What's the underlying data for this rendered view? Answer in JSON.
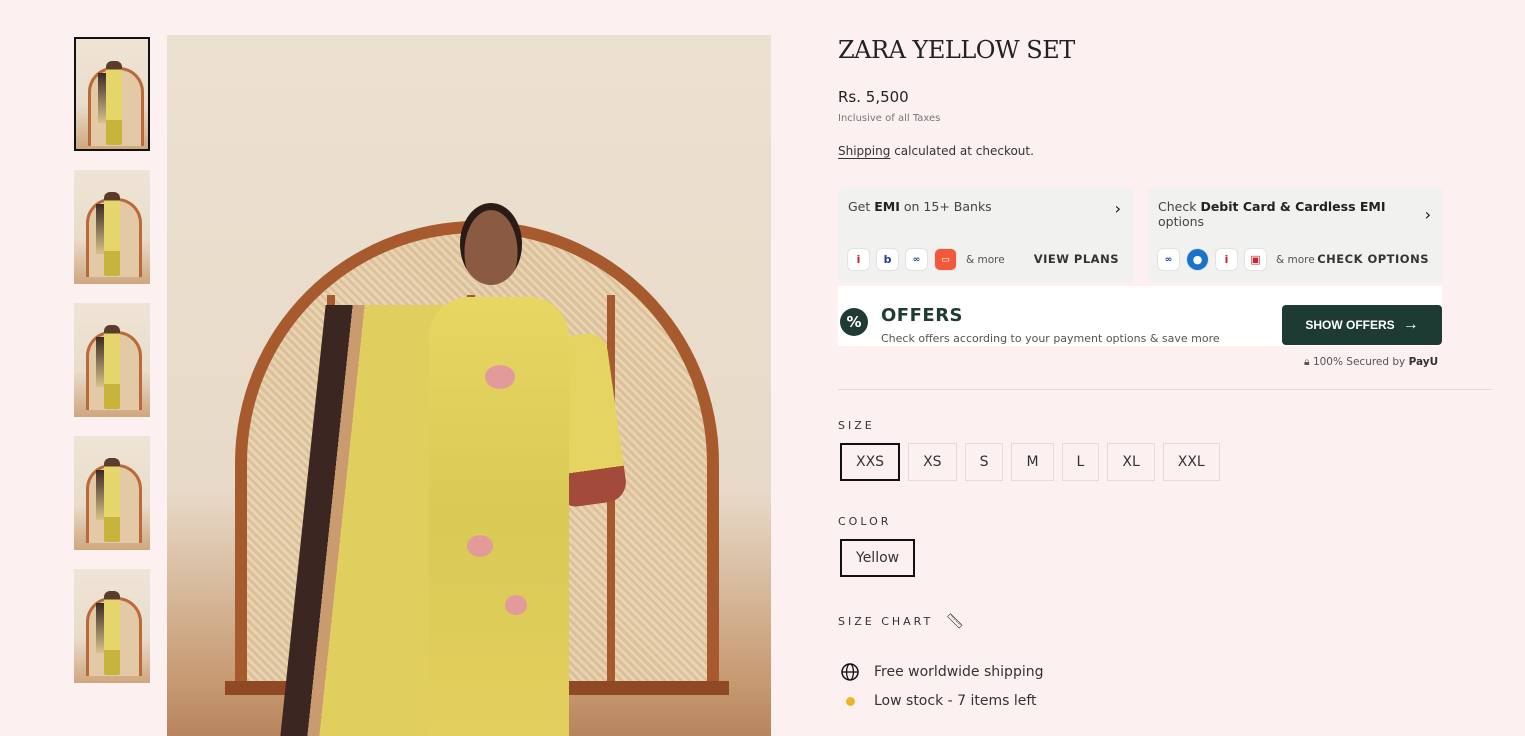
{
  "product": {
    "title": "ZARA YELLOW SET",
    "price": "Rs. 5,500",
    "tax_note": "Inclusive of all Taxes",
    "shipping_link": "Shipping",
    "shipping_note": "calculated at checkout."
  },
  "emi": {
    "prefix": "Get",
    "bold": "EMI",
    "suffix": "on 15+ Banks",
    "more": "& more",
    "cta": "VIEW PLANS"
  },
  "debit": {
    "prefix": "Check",
    "bold": "Debit Card & Cardless EMI",
    "suffix": "options",
    "more": "& more",
    "cta": "CHECK OPTIONS"
  },
  "offers": {
    "heading": "OFFERS",
    "subtext": "Check offers according to your payment options & save more",
    "button": "SHOW OFFERS",
    "secured": "100% Secured by",
    "brand": "PayU"
  },
  "size": {
    "label": "SIZE",
    "options": [
      "XXS",
      "XS",
      "S",
      "M",
      "L",
      "XL",
      "XXL"
    ],
    "selected": "XXS"
  },
  "color": {
    "label": "COLOR",
    "options": [
      "Yellow"
    ],
    "selected": "Yellow"
  },
  "size_chart": "SIZE CHART",
  "features": {
    "shipping": "Free worldwide shipping",
    "stock": "Low stock - 7 items left"
  },
  "colors": {
    "background": "#fdf0f0",
    "accent": "#1d3b33",
    "stock_dot": "#f2b322"
  }
}
